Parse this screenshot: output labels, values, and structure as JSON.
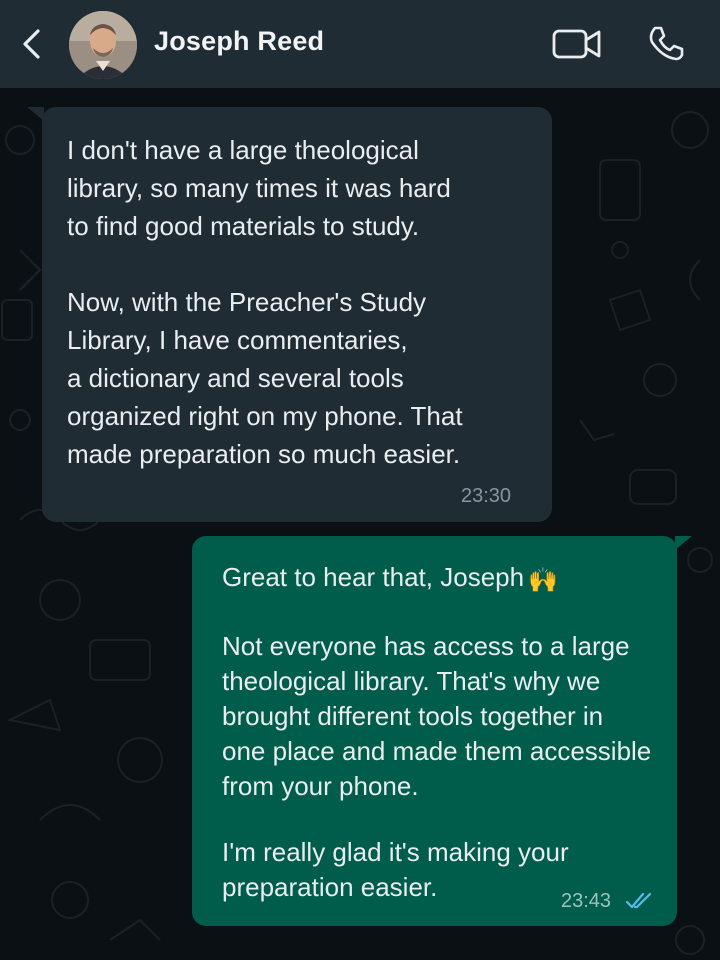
{
  "header": {
    "contact_name": "Joseph Reed"
  },
  "messages": [
    {
      "direction": "incoming",
      "paragraphs": [
        [
          "I don't have a large theological",
          "library, so many times it was hard",
          "to find good materials to study."
        ],
        [
          "Now, with the Preacher's Study",
          "Library, I have commentaries,",
          "a dictionary and several tools",
          "organized right on my phone. That",
          "made preparation so much easier."
        ]
      ],
      "time": "23:30"
    },
    {
      "direction": "outgoing",
      "greeting": "Great to hear that, Joseph",
      "greeting_emoji": "🙌",
      "paragraphs": [
        [
          "Not everyone has access to a large",
          "theological library. That's why we",
          "brought different tools together in",
          "one place and made them accessible",
          "from your phone."
        ],
        [
          "I'm really glad it's making your",
          "preparation easier."
        ]
      ],
      "time": "23:43",
      "status": "read"
    }
  ],
  "colors": {
    "header_bg": "#1f2c33",
    "chat_bg": "#0b1014",
    "incoming_bubble": "#202c33",
    "outgoing_bubble": "#005c4b",
    "read_ticks": "#53bdeb"
  }
}
